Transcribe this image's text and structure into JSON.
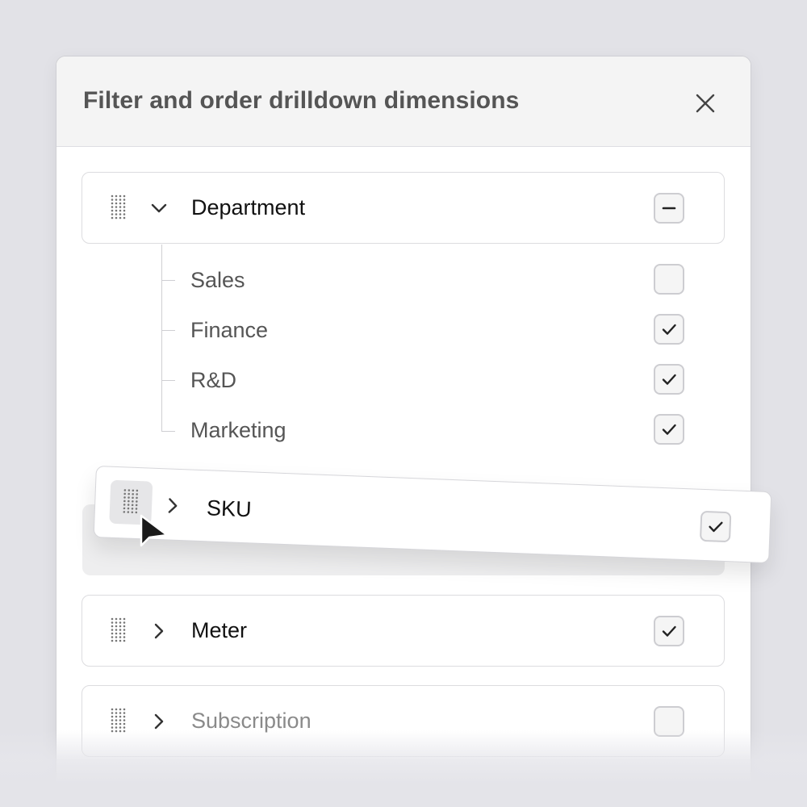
{
  "modal": {
    "title": "Filter and order drilldown dimensions",
    "close_icon": "close-icon"
  },
  "dimensions": [
    {
      "label": "Department",
      "expanded": true,
      "checkbox_state": "indeterminate",
      "children": [
        {
          "label": "Sales",
          "checked": false
        },
        {
          "label": "Finance",
          "checked": true
        },
        {
          "label": "R&D",
          "checked": true
        },
        {
          "label": "Marketing",
          "checked": true
        }
      ]
    },
    {
      "label": "SKU",
      "expanded": false,
      "checkbox_state": "checked",
      "dragging": true
    },
    {
      "label": "Meter",
      "expanded": false,
      "checkbox_state": "checked"
    },
    {
      "label": "Subscription",
      "expanded": false,
      "checkbox_state": "unchecked",
      "muted": true
    }
  ],
  "icons": {
    "drag_handle": "drag-handle-icon",
    "chevron_down": "chevron-down-icon",
    "chevron_right": "chevron-right-icon",
    "check": "check-icon",
    "minus": "minus-icon",
    "cursor": "pointer-cursor-icon"
  },
  "colors": {
    "background": "#e2e2e7",
    "header_bg": "#f4f4f4",
    "text_primary": "#111111",
    "text_secondary": "#555555",
    "text_muted": "#8a8a8a",
    "border": "#dcdcdf"
  }
}
